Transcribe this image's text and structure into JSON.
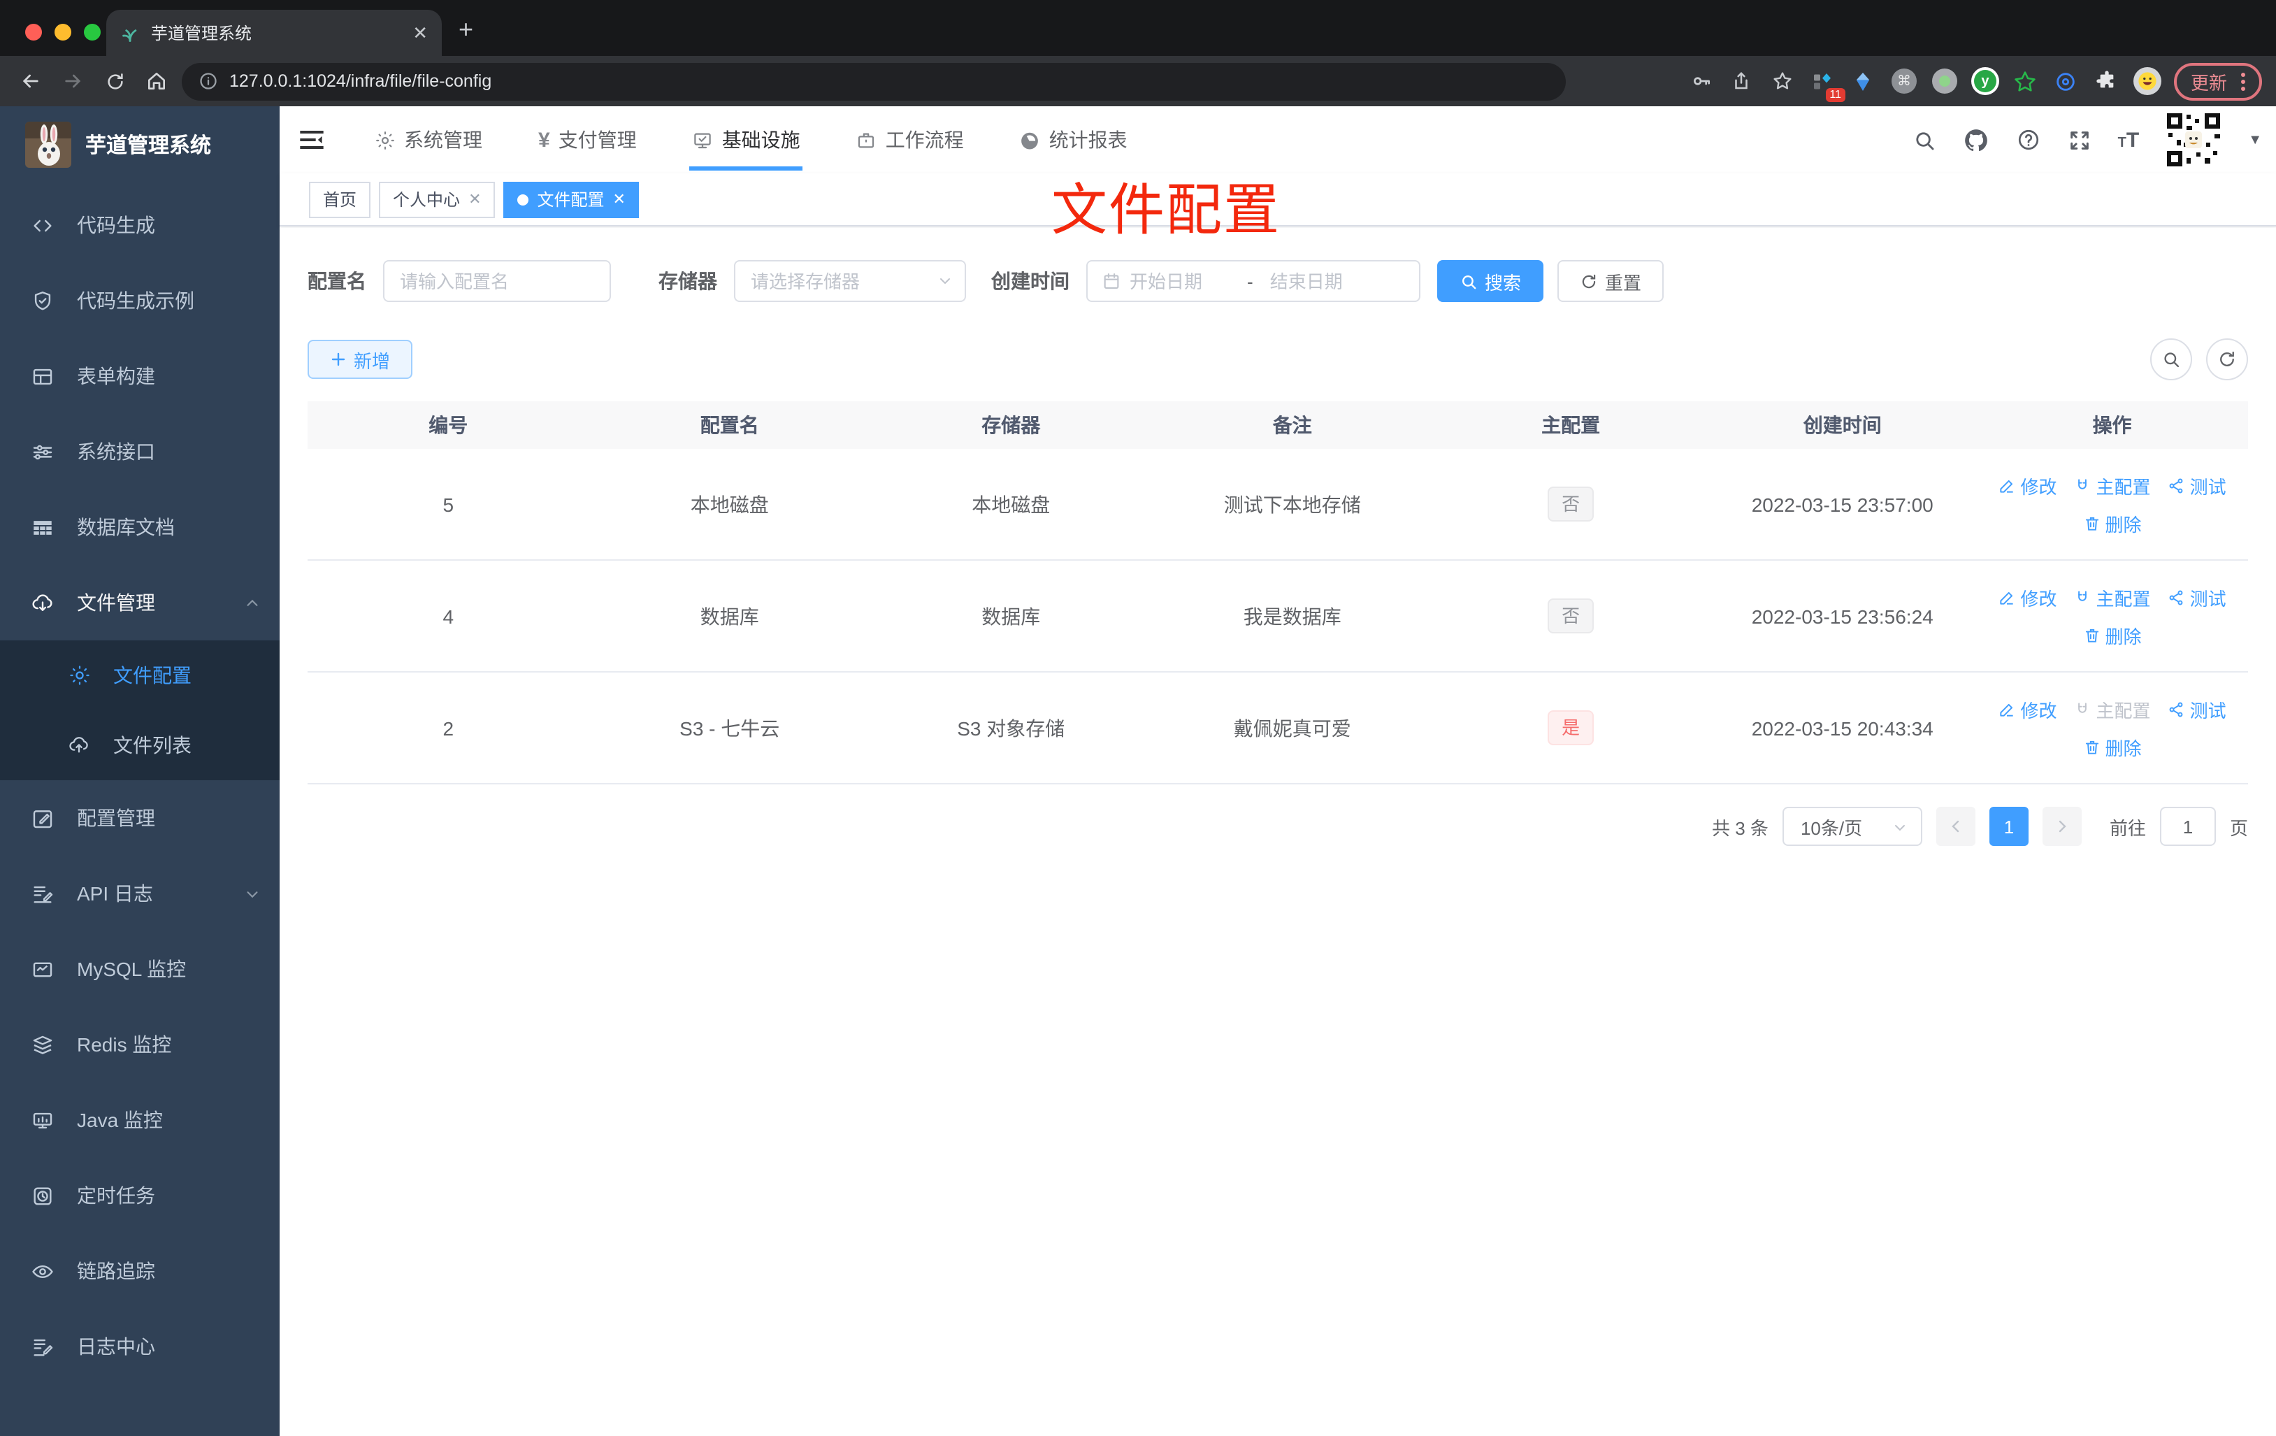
{
  "browser": {
    "tab_title": "芋道管理系统",
    "url": "127.0.0.1:1024/infra/file/file-config",
    "ext_badge": "11",
    "update_label": "更新"
  },
  "sidebar": {
    "title": "芋道管理系统",
    "items": [
      {
        "label": "代码生成"
      },
      {
        "label": "代码生成示例"
      },
      {
        "label": "表单构建"
      },
      {
        "label": "系统接口"
      },
      {
        "label": "数据库文档"
      },
      {
        "label": "文件管理"
      },
      {
        "label": "文件配置"
      },
      {
        "label": "文件列表"
      },
      {
        "label": "配置管理"
      },
      {
        "label": "API 日志"
      },
      {
        "label": "MySQL 监控"
      },
      {
        "label": "Redis 监控"
      },
      {
        "label": "Java 监控"
      },
      {
        "label": "定时任务"
      },
      {
        "label": "链路追踪"
      },
      {
        "label": "日志中心"
      }
    ]
  },
  "nav": {
    "items": [
      {
        "label": "系统管理"
      },
      {
        "label": "支付管理"
      },
      {
        "label": "基础设施"
      },
      {
        "label": "工作流程"
      },
      {
        "label": "统计报表"
      }
    ]
  },
  "tabs": [
    {
      "label": "首页"
    },
    {
      "label": "个人中心"
    },
    {
      "label": "文件配置"
    }
  ],
  "annotation": {
    "text": "文件配置"
  },
  "filters": {
    "name_label": "配置名",
    "name_placeholder": "请输入配置名",
    "storage_label": "存储器",
    "storage_placeholder": "请选择存储器",
    "time_label": "创建时间",
    "start_placeholder": "开始日期",
    "separator": "-",
    "end_placeholder": "结束日期",
    "search": "搜索",
    "reset": "重置"
  },
  "toolbar": {
    "add": "新增"
  },
  "table": {
    "columns": [
      "编号",
      "配置名",
      "存储器",
      "备注",
      "主配置",
      "创建时间",
      "操作"
    ],
    "actions": {
      "edit": "修改",
      "master": "主配置",
      "test": "测试",
      "delete": "删除"
    },
    "rows": [
      {
        "id": "5",
        "name": "本地磁盘",
        "storage": "本地磁盘",
        "remark": "测试下本地存储",
        "master": "否",
        "created": "2022-03-15 23:57:00"
      },
      {
        "id": "4",
        "name": "数据库",
        "storage": "数据库",
        "remark": "我是数据库",
        "master": "否",
        "created": "2022-03-15 23:56:24"
      },
      {
        "id": "2",
        "name": "S3 - 七牛云",
        "storage": "S3 对象存储",
        "remark": "戴佩妮真可爱",
        "master": "是",
        "created": "2022-03-15 20:43:34"
      }
    ]
  },
  "pagination": {
    "total": "共 3 条",
    "page_size": "10条/页",
    "page": "1",
    "goto": "前往",
    "goto_value": "1",
    "unit": "页"
  },
  "colors": {
    "primary": "#409EFF",
    "annotation_red": "#F3280D",
    "danger": "#F56C6C",
    "sidebar": "#304156"
  }
}
